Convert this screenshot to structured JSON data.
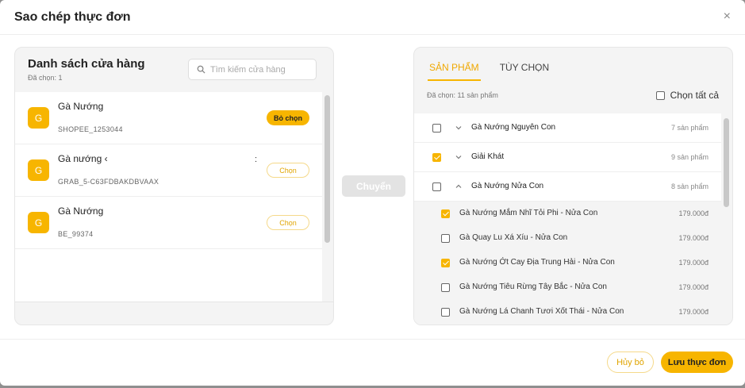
{
  "dialog": {
    "title": "Sao chép thực đơn",
    "close_label": "×"
  },
  "stores": {
    "title": "Danh sách cửa hàng",
    "selected_text": "Đã chọn: 1",
    "search_placeholder": "Tìm kiếm cửa hàng",
    "items": [
      {
        "avatar": "G",
        "name": "Gà Nướng",
        "code": "SHOPEE_1253044",
        "extra": "",
        "action": "Bỏ chọn",
        "selected": true
      },
      {
        "avatar": "G",
        "name": "Gà nướng ‹",
        "code": "GRAB_5-C63FDBAKDBVAAX",
        "extra": ":",
        "action": "Chọn",
        "selected": false
      },
      {
        "avatar": "G",
        "name": "Gà Nướng",
        "code": "BE_99374",
        "extra": "",
        "action": "Chọn",
        "selected": false
      }
    ]
  },
  "move_button": "Chuyển",
  "products": {
    "tabs": [
      {
        "label": "SẢN PHẨM",
        "active": true
      },
      {
        "label": "TÙY CHỌN",
        "active": false
      }
    ],
    "selected_text": "Đã chọn: 11 sản phẩm",
    "select_all_label": "Chọn tất cả",
    "groups": [
      {
        "name": "Gà Nướng Nguyên Con",
        "count": "7 sản phẩm",
        "checked": false,
        "expanded": false,
        "items": []
      },
      {
        "name": "Giải Khát",
        "count": "9 sản phẩm",
        "checked": true,
        "expanded": false,
        "items": []
      },
      {
        "name": "Gà Nướng Nửa Con",
        "count": "8 sản phẩm",
        "checked": false,
        "expanded": true,
        "items": [
          {
            "name": "Gà Nướng Mắm Nhĩ Tỏi Phi - Nửa Con",
            "price": "179.000đ",
            "checked": true
          },
          {
            "name": "Gà Quay Lu Xá Xíu - Nửa Con",
            "price": "179.000đ",
            "checked": false
          },
          {
            "name": "Gà Nướng Ớt Cay Địa Trung Hải - Nửa Con",
            "price": "179.000đ",
            "checked": true
          },
          {
            "name": "Gà Nướng Tiêu Rừng Tây Bắc - Nửa Con",
            "price": "179.000đ",
            "checked": false
          },
          {
            "name": "Gà Nướng Lá Chanh Tươi Xốt Thái - Nửa Con",
            "price": "179.000đ",
            "checked": false
          }
        ]
      }
    ]
  },
  "footer": {
    "cancel_label": "Hủy bỏ",
    "save_label": "Lưu thực đơn"
  },
  "colors": {
    "accent": "#f7b500",
    "disabled": "#e3e3e3"
  }
}
